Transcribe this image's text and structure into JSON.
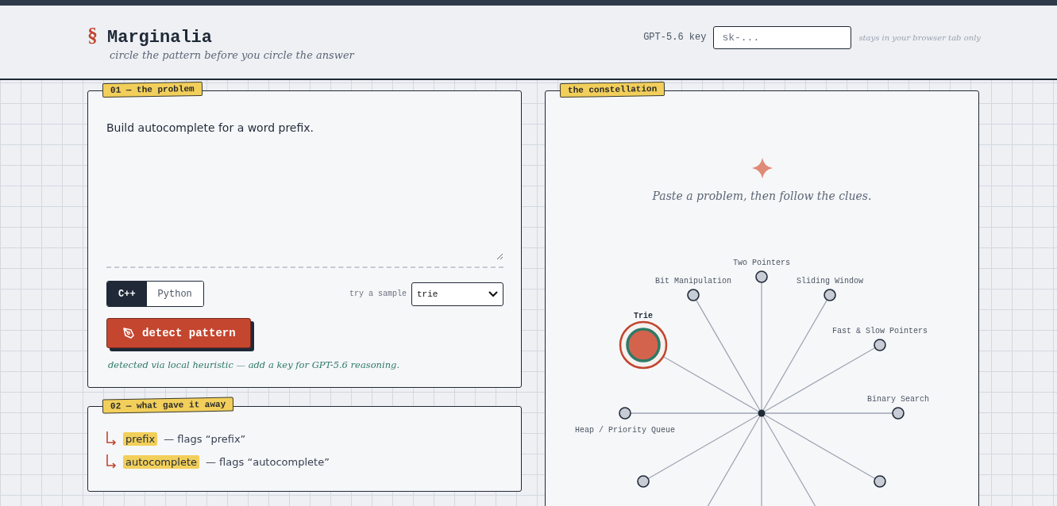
{
  "header": {
    "mark": "§",
    "title": "Marginalia",
    "tagline": "circle the pattern before you circle the answer",
    "key_label": "GPT-5.6 key",
    "key_placeholder": "sk-...",
    "key_note": "stays in your browser tab only"
  },
  "problem": {
    "tag": "01 — the problem",
    "text": "Build autocomplete for a word prefix.",
    "languages": [
      {
        "label": "C++",
        "selected": true
      },
      {
        "label": "Python",
        "selected": false
      }
    ],
    "sample_label": "try a sample",
    "sample_value": "trie",
    "detect_button": "detect pattern",
    "status": "detected via local heuristic — add a key for GPT-5.6 reasoning."
  },
  "clues": {
    "tag": "02 — what gave it away",
    "items": [
      {
        "keyword": "prefix",
        "text": "— flags “prefix”"
      },
      {
        "keyword": "autocomplete",
        "text": "— flags “autocomplete”"
      }
    ]
  },
  "constellation": {
    "tag": "the constellation",
    "hint": "Paste a problem, then follow the clues.",
    "nodes": [
      {
        "label": "Two Pointers",
        "selected": false
      },
      {
        "label": "Bit Manipulation",
        "selected": false
      },
      {
        "label": "Sliding Window",
        "selected": false
      },
      {
        "label": "Trie",
        "selected": true
      },
      {
        "label": "Fast & Slow Pointers",
        "selected": false
      },
      {
        "label": "Heap / Priority Queue",
        "selected": false
      },
      {
        "label": "Binary Search",
        "selected": false
      },
      {
        "selected": false
      },
      {
        "selected": false
      }
    ]
  }
}
